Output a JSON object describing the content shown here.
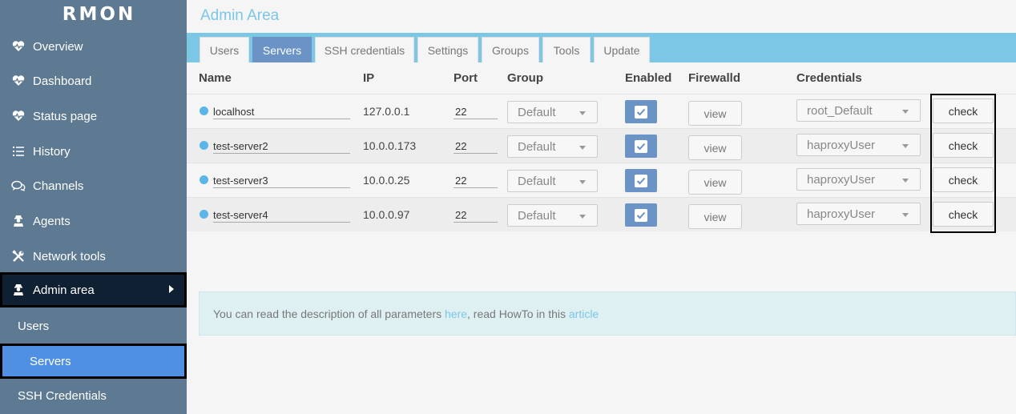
{
  "app": {
    "logo": "RMON",
    "page_title": "Admin Area"
  },
  "sidebar": {
    "items": [
      {
        "label": "Overview",
        "icon": "heart-pulse-icon"
      },
      {
        "label": "Dashboard",
        "icon": "heart-pulse-icon"
      },
      {
        "label": "Status page",
        "icon": "heart-pulse-icon"
      },
      {
        "label": "History",
        "icon": "list-icon"
      },
      {
        "label": "Channels",
        "icon": "chat-icon"
      },
      {
        "label": "Agents",
        "icon": "agent-icon"
      },
      {
        "label": "Network tools",
        "icon": "tools-icon"
      },
      {
        "label": "Admin area",
        "icon": "agent-icon"
      }
    ],
    "sub_items": [
      {
        "label": "Users"
      },
      {
        "label": "Servers"
      },
      {
        "label": "SSH Credentials"
      }
    ]
  },
  "tabs": [
    "Users",
    "Servers",
    "SSH credentials",
    "Settings",
    "Groups",
    "Tools",
    "Update"
  ],
  "table": {
    "headers": {
      "name": "Name",
      "ip": "IP",
      "port": "Port",
      "group": "Group",
      "enabled": "Enabled",
      "firewalld": "Firewalld",
      "credentials": "Credentials"
    },
    "rows": [
      {
        "name": "localhost",
        "ip": "127.0.0.1",
        "port": "22",
        "group": "Default",
        "enabled": true,
        "firewalld": "view",
        "credentials": "root_Default",
        "action": "check"
      },
      {
        "name": "test-server2",
        "ip": "10.0.0.173",
        "port": "22",
        "group": "Default",
        "enabled": true,
        "firewalld": "view",
        "credentials": "haproxyUser",
        "action": "check"
      },
      {
        "name": "test-server3",
        "ip": "10.0.0.25",
        "port": "22",
        "group": "Default",
        "enabled": true,
        "firewalld": "view",
        "credentials": "haproxyUser",
        "action": "check"
      },
      {
        "name": "test-server4",
        "ip": "10.0.0.97",
        "port": "22",
        "group": "Default",
        "enabled": true,
        "firewalld": "view",
        "credentials": "haproxyUser",
        "action": "check"
      }
    ]
  },
  "info": {
    "text1": "You can read the description of all parameters ",
    "link1": "here",
    "text2": ", read HowTo in this ",
    "link2": "article"
  },
  "colors": {
    "sidebar": "#5d7a92",
    "accent": "#7cc6e6",
    "active_tab": "#6b93c6",
    "selected": "#4f90e2"
  }
}
